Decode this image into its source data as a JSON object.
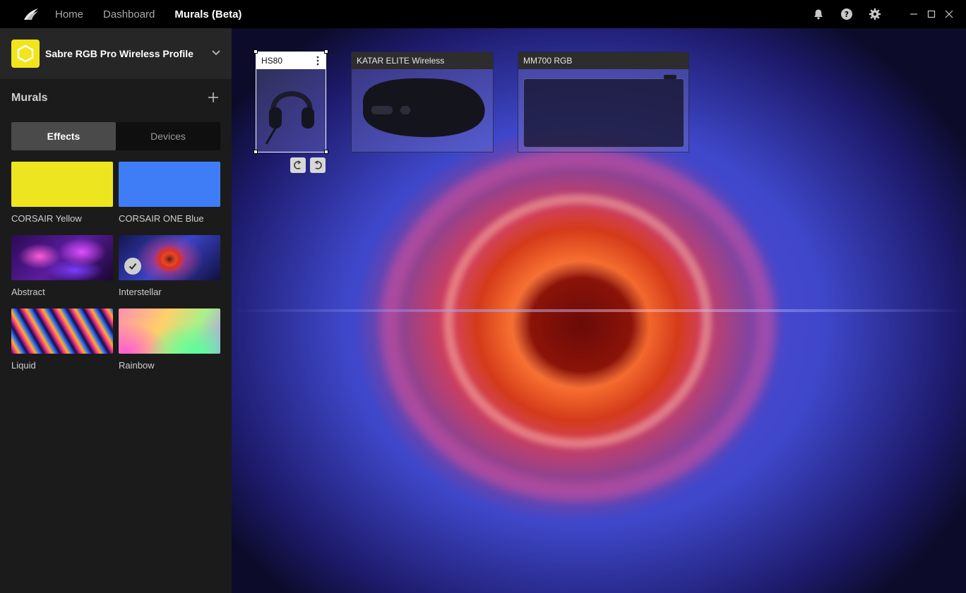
{
  "nav": {
    "items": [
      {
        "label": "Home",
        "active": false
      },
      {
        "label": "Dashboard",
        "active": false
      },
      {
        "label": "Murals (Beta)",
        "active": true
      }
    ]
  },
  "titlebar_icons": [
    "bell-icon",
    "help-icon",
    "gear-icon",
    "minimize-icon",
    "maximize-icon",
    "close-icon"
  ],
  "profile": {
    "name": "Sabre RGB Pro Wireless Profile",
    "icon_color": "#f2e51c"
  },
  "murals": {
    "title": "Murals",
    "tabs": [
      {
        "label": "Effects",
        "active": true
      },
      {
        "label": "Devices",
        "active": false
      }
    ],
    "effects": [
      {
        "label": "CORSAIR Yellow",
        "color": "#ede51f",
        "selected": false
      },
      {
        "label": "CORSAIR ONE Blue",
        "color": "#3f7df6",
        "selected": false
      },
      {
        "label": "Abstract",
        "selected": false
      },
      {
        "label": "Interstellar",
        "selected": true
      },
      {
        "label": "Liquid",
        "selected": false
      },
      {
        "label": "Rainbow",
        "selected": false
      }
    ]
  },
  "canvas": {
    "devices": [
      {
        "name": "HS80",
        "selected": true
      },
      {
        "name": "KATAR ELITE Wireless",
        "selected": false
      },
      {
        "name": "MM700 RGB",
        "selected": false
      }
    ]
  }
}
